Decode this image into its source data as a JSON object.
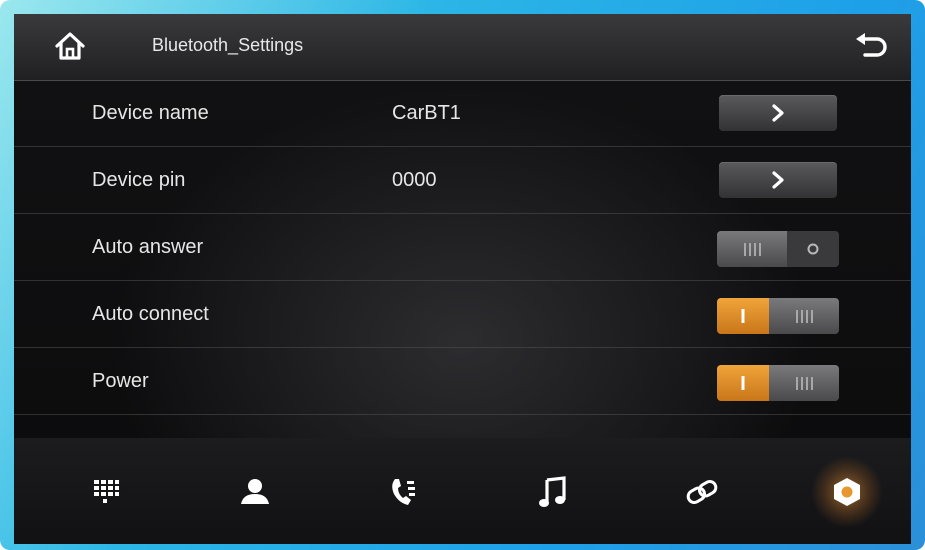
{
  "header": {
    "title": "Bluetooth_Settings",
    "home_icon": "home-icon",
    "back_icon": "back-arrow-icon"
  },
  "settings": {
    "device_name": {
      "label": "Device name",
      "value": "CarBT1",
      "action_icon": "chevron-right-icon"
    },
    "device_pin": {
      "label": "Device pin",
      "value": "0000",
      "action_icon": "chevron-right-icon"
    },
    "auto_answer": {
      "label": "Auto answer",
      "state": "off"
    },
    "auto_connect": {
      "label": "Auto connect",
      "state": "on"
    },
    "power": {
      "label": "Power",
      "state": "on"
    }
  },
  "toggle_glyphs": {
    "on": "I",
    "off": "O"
  },
  "bottom_nav": [
    {
      "name": "dialpad",
      "icon": "dialpad-icon",
      "active": false
    },
    {
      "name": "contacts",
      "icon": "contact-icon",
      "active": false
    },
    {
      "name": "call-log",
      "icon": "phone-history-icon",
      "active": false
    },
    {
      "name": "music",
      "icon": "music-note-icon",
      "active": false
    },
    {
      "name": "pairing",
      "icon": "link-icon",
      "active": false
    },
    {
      "name": "settings",
      "icon": "gear-icon",
      "active": true
    }
  ],
  "colors": {
    "accent": "#e8962e",
    "background": "#0e0e10",
    "frame": "#22a8e6",
    "text": "#e6e6e6"
  }
}
